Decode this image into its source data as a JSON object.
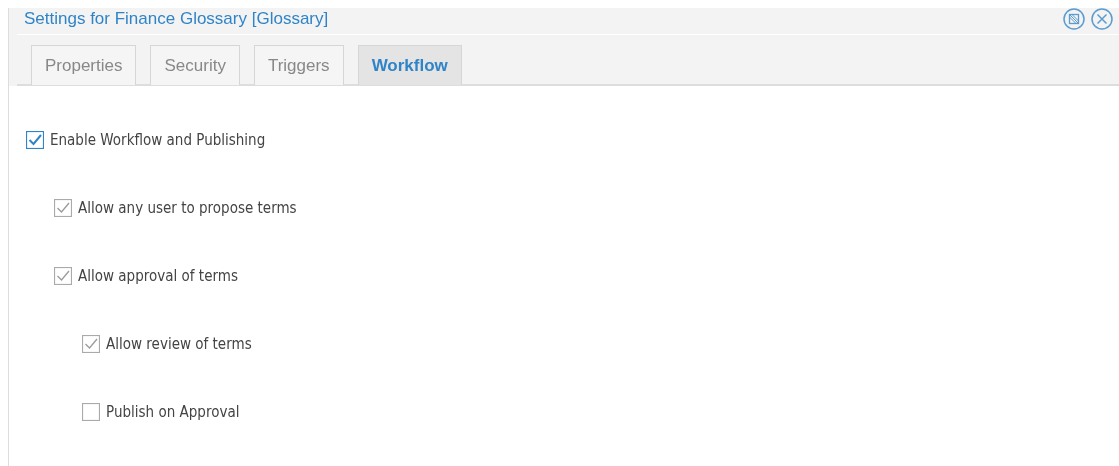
{
  "dialog": {
    "title": "Settings for Finance Glossary [Glossary]"
  },
  "tabs": [
    {
      "label": "Properties",
      "selected": false
    },
    {
      "label": "Security",
      "selected": false
    },
    {
      "label": "Triggers",
      "selected": false
    },
    {
      "label": "Workflow",
      "selected": true
    }
  ],
  "options": [
    {
      "label": "Enable Workflow and Publishing",
      "checked": true,
      "disabled": false,
      "children": [
        {
          "label": "Allow any user to propose terms",
          "checked": true,
          "disabled": true
        },
        {
          "label": "Allow approval of terms",
          "checked": true,
          "disabled": true,
          "children": [
            {
              "label": "Allow review of terms",
              "checked": true,
              "disabled": true
            },
            {
              "label": "Publish on Approval",
              "checked": false,
              "disabled": true
            }
          ]
        }
      ]
    }
  ]
}
